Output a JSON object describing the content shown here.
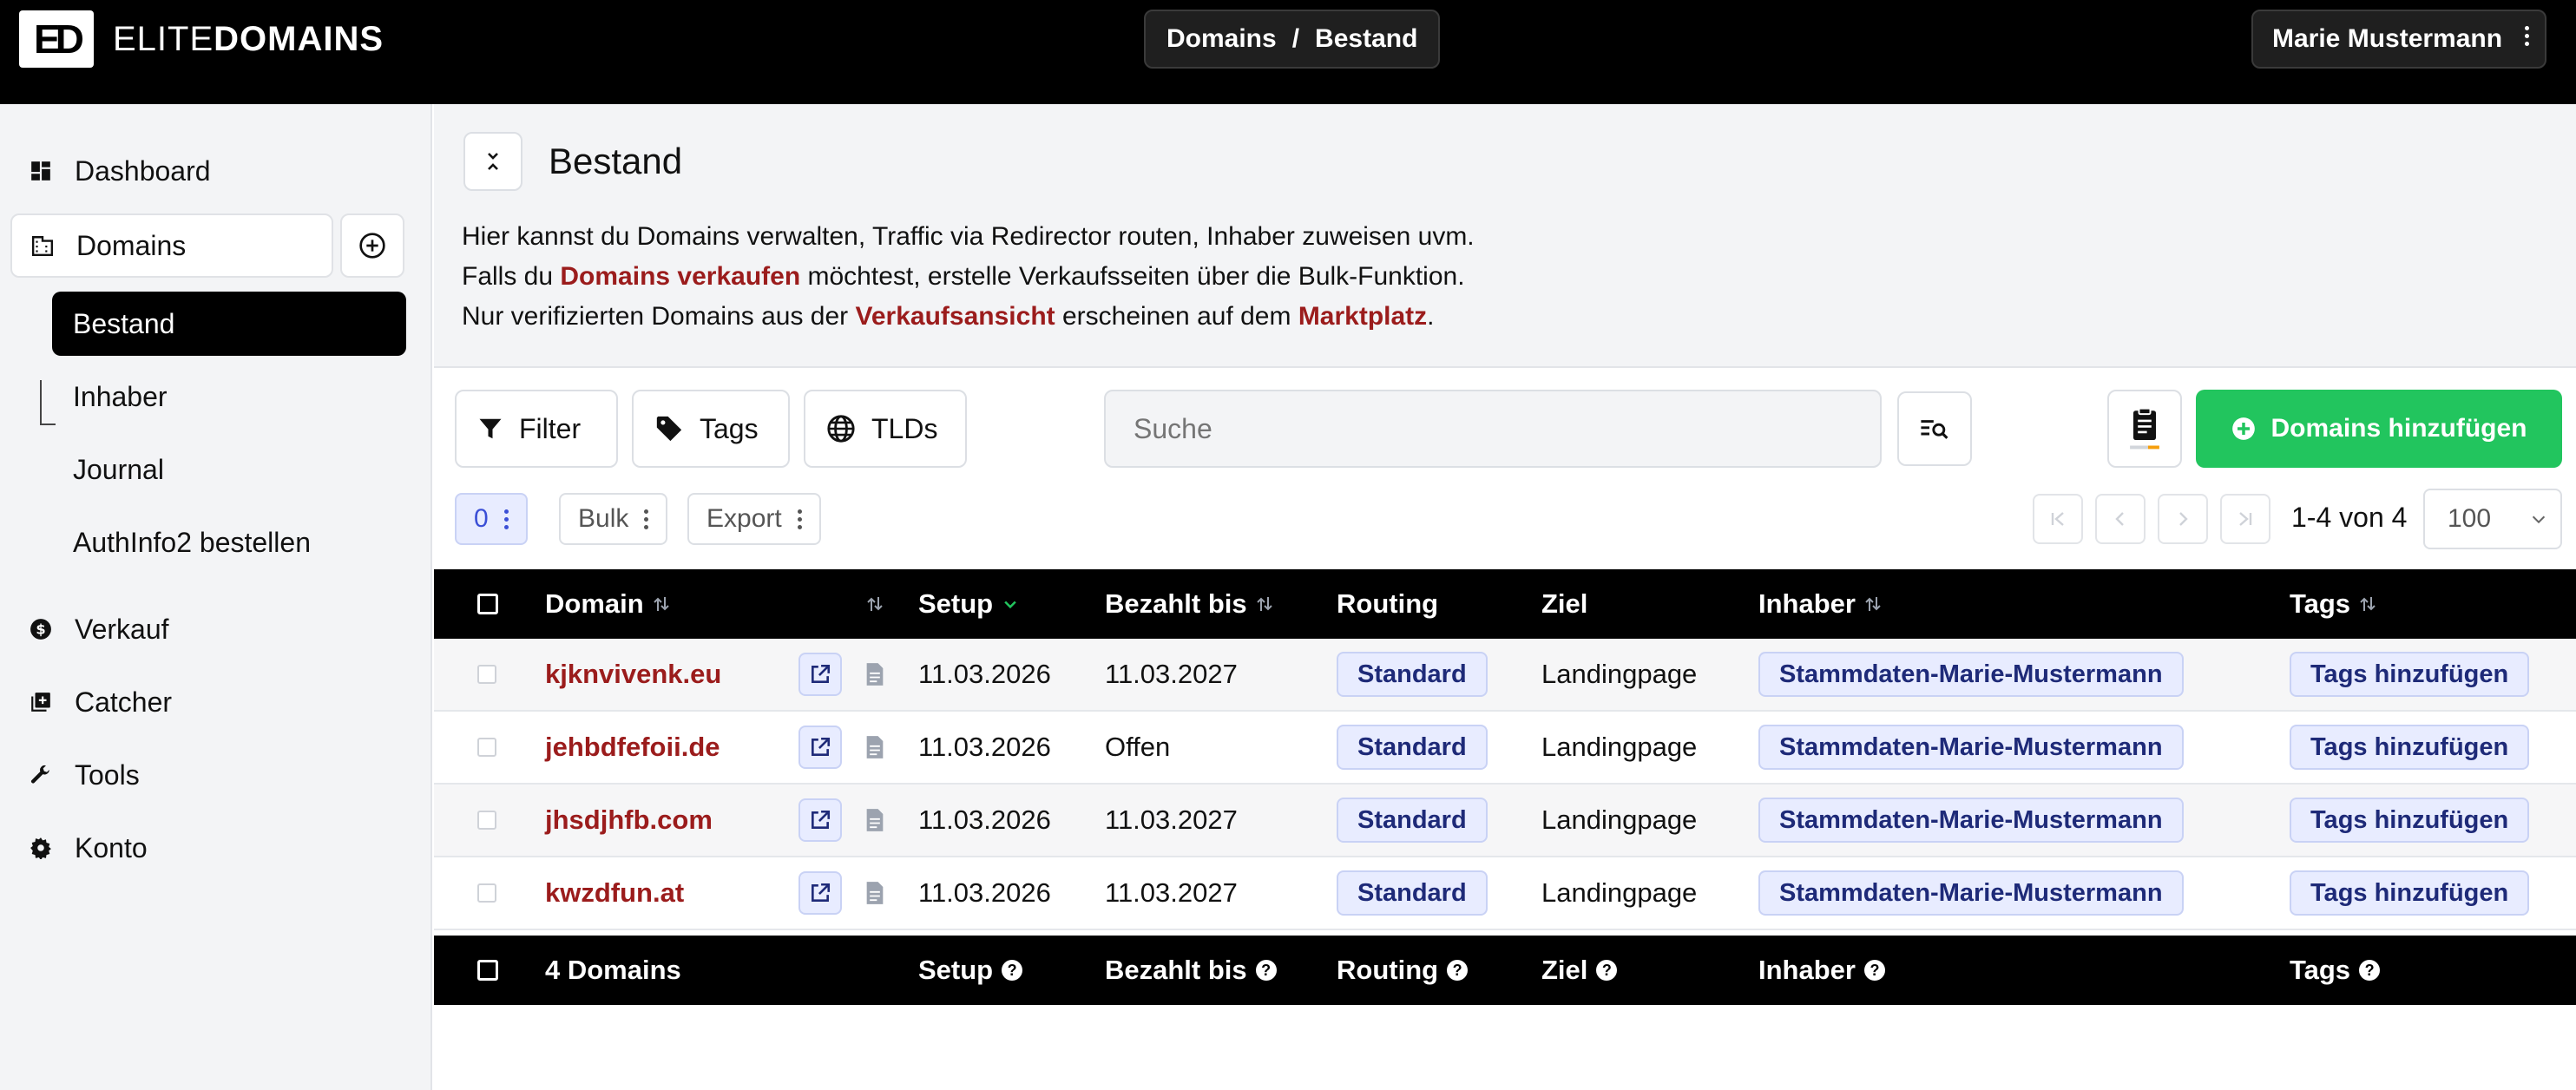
{
  "app": {
    "logo_mark": "ED",
    "logo_text_light": "ELITE",
    "logo_text_bold": "DOMAINS",
    "breadcrumb": [
      "Domains",
      "/",
      "Bestand"
    ],
    "user_name": "Marie Mustermann"
  },
  "sidebar": {
    "dashboard": "Dashboard",
    "domains": "Domains",
    "sub_items": [
      "Bestand",
      "Inhaber",
      "Journal",
      "AuthInfo2 bestellen"
    ],
    "verkauf": "Verkauf",
    "catcher": "Catcher",
    "tools": "Tools",
    "konto": "Konto"
  },
  "page": {
    "title": "Bestand",
    "line1": "Hier kannst du Domains verwalten, Traffic via Redirector routen, Inhaber zuweisen uvm.",
    "line2_pre": "Falls du ",
    "line2_link": "Domains verkaufen",
    "line2_post": " möchtest, erstelle Verkaufsseiten über die Bulk-Funktion.",
    "line3_pre": "Nur verifizierten Domains aus der ",
    "line3_link1": "Verkaufsansicht",
    "line3_mid": " erscheinen auf dem ",
    "line3_link2": "Marktplatz",
    "line3_post": "."
  },
  "toolbar": {
    "filter": "Filter",
    "tags": "Tags",
    "tlds": "TLDs",
    "search_placeholder": "Suche",
    "add_domains": "Domains hinzufügen",
    "selected_count": "0",
    "bulk": "Bulk",
    "export": "Export",
    "page_info": "1-4 von 4",
    "per_page": "100"
  },
  "colors": {
    "accent_green": "#22c55e",
    "link_red": "#9b1c1c",
    "badge_blue": "#e8ecff"
  },
  "table": {
    "headers": {
      "domain": "Domain",
      "setup": "Setup",
      "paid_until": "Bezahlt bis",
      "routing": "Routing",
      "target": "Ziel",
      "owner": "Inhaber",
      "tags": "Tags"
    },
    "rows": [
      {
        "domain": "kjknvivenk.eu",
        "setup": "11.03.2026",
        "paid_until": "11.03.2027",
        "routing": "Standard",
        "target": "Landingpage",
        "owner": "Stammdaten-Marie-Mustermann",
        "tags": "Tags hinzufügen"
      },
      {
        "domain": "jehbdfefoii.de",
        "setup": "11.03.2026",
        "paid_until": "Offen",
        "routing": "Standard",
        "target": "Landingpage",
        "owner": "Stammdaten-Marie-Mustermann",
        "tags": "Tags hinzufügen"
      },
      {
        "domain": "jhsdjhfb.com",
        "setup": "11.03.2026",
        "paid_until": "11.03.2027",
        "routing": "Standard",
        "target": "Landingpage",
        "owner": "Stammdaten-Marie-Mustermann",
        "tags": "Tags hinzufügen"
      },
      {
        "domain": "kwzdfun.at",
        "setup": "11.03.2026",
        "paid_until": "11.03.2027",
        "routing": "Standard",
        "target": "Landingpage",
        "owner": "Stammdaten-Marie-Mustermann",
        "tags": "Tags hinzufügen"
      }
    ],
    "footer": {
      "count": "4 Domains",
      "setup": "Setup",
      "paid_until": "Bezahlt bis",
      "routing": "Routing",
      "target": "Ziel",
      "owner": "Inhaber",
      "tags": "Tags",
      "help_mark": "?"
    }
  }
}
